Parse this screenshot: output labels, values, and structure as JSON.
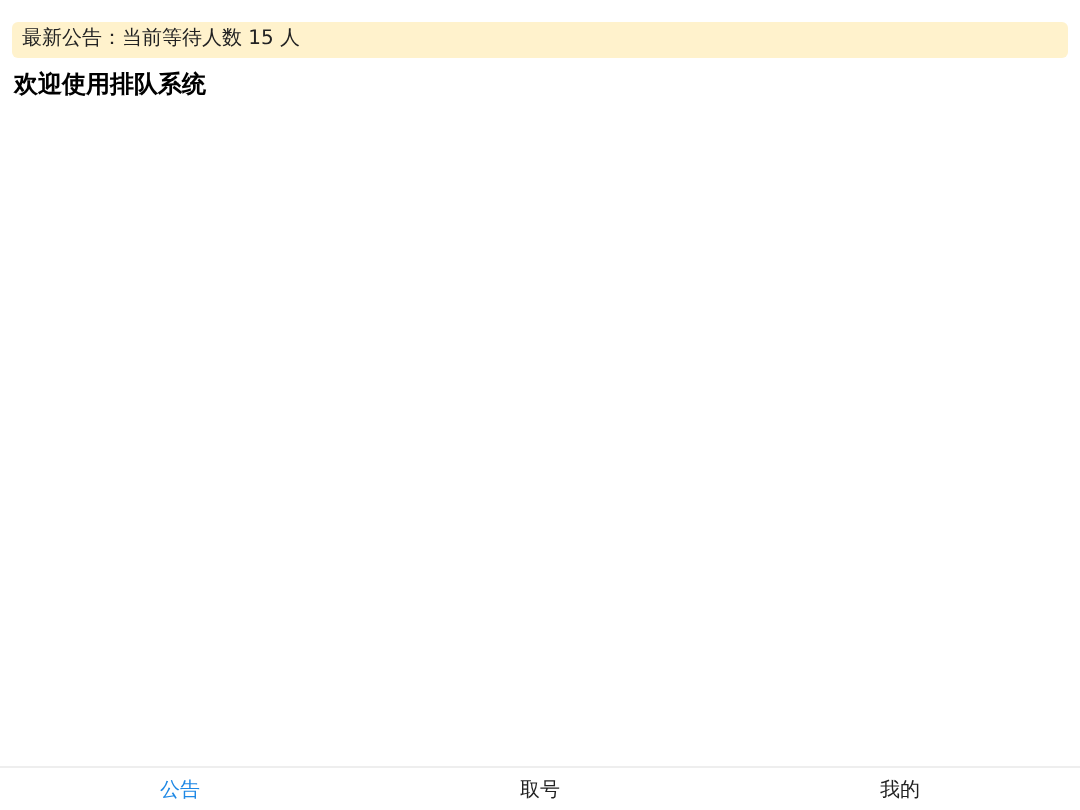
{
  "notice": "最新公告：当前等待人数 15 人",
  "title": "欢迎使用排队系统",
  "tabs": [
    {
      "label": "公告",
      "selected": true
    },
    {
      "label": "取号",
      "selected": false
    },
    {
      "label": "我的",
      "selected": false
    }
  ]
}
